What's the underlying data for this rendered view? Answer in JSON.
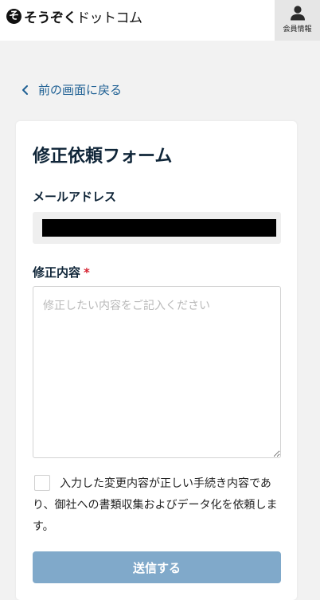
{
  "header": {
    "logo_mark": "そ",
    "logo_text_bold": "そうぞく",
    "logo_text_light": "ドットコム",
    "member_label": "会員情報",
    "member_icon": "person-icon"
  },
  "nav": {
    "back_label": "前の画面に戻る",
    "back_icon": "chevron-left-icon"
  },
  "form": {
    "title": "修正依頼フォーム",
    "email_label": "メールアドレス",
    "email_value": "",
    "content_label": "修正内容",
    "required_mark": "*",
    "content_placeholder": "修正したい内容をご記入ください",
    "agree_checked": false,
    "agree_text": "入力した変更内容が正しい手続き内容であり、御社への書類収集およびデータ化を依頼します。",
    "submit_label": "送信する"
  },
  "colors": {
    "link": "#1d5f93",
    "heading": "#0f2538",
    "required": "#d6202f",
    "submit_bg": "#80a9ca",
    "page_bg": "#f2f2f2"
  }
}
